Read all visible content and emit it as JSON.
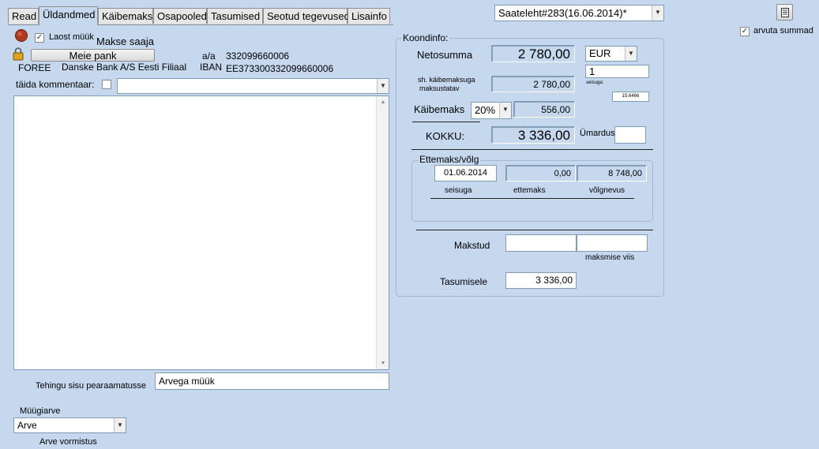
{
  "tabs": [
    "Read",
    "Üldandmed",
    "Käibemaks",
    "Osapooled",
    "Tasumised",
    "Seotud tegevused",
    "Lisainfo"
  ],
  "active_tab": 1,
  "header": {
    "doc_select": "Saateleht#283(16.06.2014)*",
    "recalc_label": "arvuta summad"
  },
  "payee": {
    "warehouse_sale_label": "Laost müük",
    "payee_label": "Makse saaja",
    "bank_button": "Meie pank",
    "account_label": "a/a",
    "account_number": "332099660006",
    "company_code": "FOREE",
    "bank_name": "Danske Bank A/S Eesti Filiaal",
    "iban_label": "IBAN",
    "iban": "EE373300332099660006"
  },
  "comment": {
    "label": "täida kommentaar:",
    "value": ""
  },
  "transaction": {
    "label": "Tehingu sisu pearaamatusse",
    "value": "Arvega müük"
  },
  "sales_invoice": {
    "label": "Müügiarve",
    "value": "Arve",
    "format_label": "Arve vormistus"
  },
  "summary": {
    "title": "Koondinfo:",
    "net_label": "Netosumma",
    "net_value": "2 780,00",
    "currency": "EUR",
    "rate_value": "1",
    "rate_label": "seisuga:",
    "rate_date": "15.6466",
    "vat_base_label_1": "sh. käibemaksuga",
    "vat_base_label_2": "maksustatav",
    "vat_base_value": "2 780,00",
    "vat_label": "Käibemaks",
    "vat_rate": "20%",
    "vat_value": "556,00",
    "total_label": "KOKKU:",
    "total_value": "3 336,00",
    "rounding_label": "Ümardus",
    "rounding_value": ""
  },
  "prepayment": {
    "title": "Ettemaks/võlg",
    "date_value": "01.06.2014",
    "prepay_value": "0,00",
    "debt_value": "8 748,00",
    "date_label": "seisuga",
    "prepay_label": "ettemaks",
    "debt_label": "võlgnevus"
  },
  "payment": {
    "paid_label": "Makstud",
    "paid_value": "",
    "method_value": "",
    "method_label": "maksmise viis",
    "to_pay_label": "Tasumisele",
    "to_pay_value": "3 336,00"
  }
}
